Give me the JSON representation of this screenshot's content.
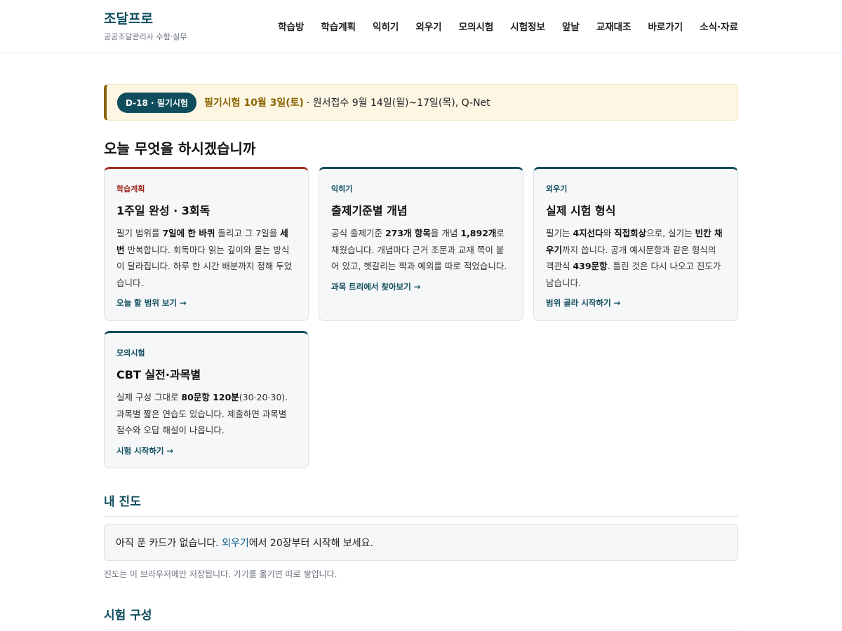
{
  "brand": {
    "title": "조달프로",
    "subtitle": "공공조달관리사 수험·실무"
  },
  "nav": [
    "학습방",
    "학습계획",
    "익히기",
    "외우기",
    "모의시험",
    "시험정보",
    "앞날",
    "교재대조",
    "바로가기",
    "소식·자료"
  ],
  "dday": {
    "badge": "D-18 · 필기시험",
    "exam": "필기시험 10월 3일(토)",
    "rest": "· 원서접수 9월 14일(월)~17일(목), Q-Net"
  },
  "today_heading": "오늘 무엇을 하시겠습니까",
  "cards": [
    {
      "kicker": "학습계획",
      "title": "1주일 완성 · 3회독",
      "body": [
        "필기 범위를 ",
        "7일에 한 바퀴",
        " 돌리고 그 7일을 ",
        "세 번",
        " 반복합니다. 회독마다 읽는 깊이와 묻는 방식이 달라집니다. 하루 한 시간 배분까지 정해 두었습니다."
      ],
      "link": "오늘 할 범위 보기 →"
    },
    {
      "kicker": "익히기",
      "title": "출제기준별 개념",
      "body": [
        "공식 출제기준 ",
        "273개 항목",
        "을 개념 ",
        "1,892개",
        "로 채웠습니다. 개념마다 근거 조문과 교재 쪽이 붙어 있고, 헷갈리는 짝과 예외를 따로 적었습니다."
      ],
      "link": "과목 트리에서 찾아보기 →"
    },
    {
      "kicker": "외우기",
      "title": "실제 시험 형식",
      "body": [
        "필기는 ",
        "4지선다",
        "와 ",
        "직접회상",
        "으로, 실기는 ",
        "빈칸 채우기",
        "까지 씁니다. 공개 예시문항과 같은 형식의 객관식 ",
        "439문항",
        ". 틀린 것은 다시 나오고 진도가 남습니다."
      ],
      "link": "범위 골라 시작하기 →"
    },
    {
      "kicker": "모의시험",
      "title": "CBT 실전·과목별",
      "body": [
        "실제 구성 그대로 ",
        "80문항 120분",
        "(30·20·30). 과목별 짧은 연습도 있습니다. 제출하면 과목별 점수와 오답 해설이 나옵니다."
      ],
      "link": "시험 시작하기 →"
    }
  ],
  "progress": {
    "heading": "내 진도",
    "msg_before": "아직 푼 카드가 없습니다. ",
    "msg_link": "외우기",
    "msg_after": "에서 20장부터 시작해 보세요.",
    "note": "진도는 이 브라우저에만 저장됩니다. 기기를 옮기면 따로 쌓입니다."
  },
  "exam_structure": {
    "heading": "시험 구성"
  }
}
